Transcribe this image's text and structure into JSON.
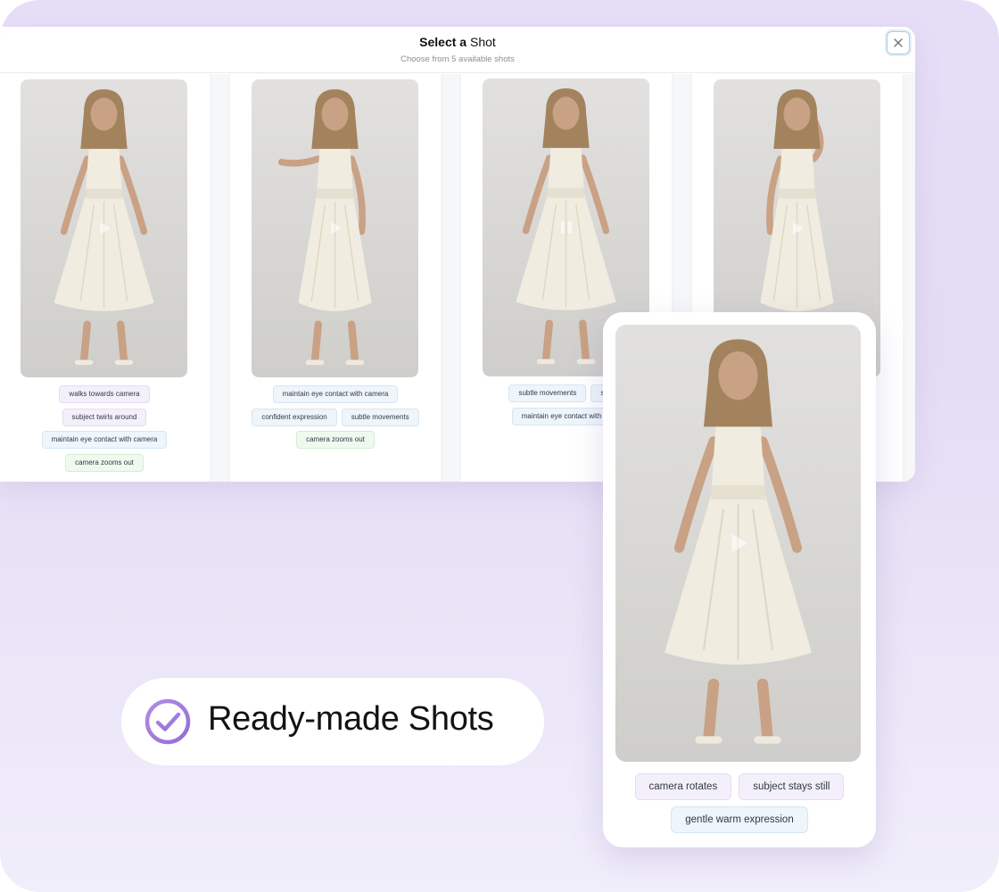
{
  "modal": {
    "title_bold": "Select a",
    "title_rest": " Shot",
    "subtitle": "Choose from 5 available shots",
    "close_icon": "close-icon"
  },
  "cards": [
    {
      "state": "play",
      "tags": [
        [
          {
            "text": "walks towards camera",
            "color": "purple"
          }
        ],
        [
          {
            "text": "subject twirls around",
            "color": "purple"
          }
        ],
        [
          {
            "text": "maintain eye contact with camera",
            "color": "blue"
          }
        ],
        [
          {
            "text": "camera zooms out",
            "color": "green"
          }
        ]
      ]
    },
    {
      "state": "play",
      "tags": [
        [
          {
            "text": "maintain eye contact with camera",
            "color": "blue"
          }
        ],
        [
          {
            "text": "confident expression",
            "color": "blue"
          },
          {
            "text": "subtle movements",
            "color": "blue"
          }
        ],
        [
          {
            "text": "camera zooms out",
            "color": "green"
          }
        ]
      ]
    },
    {
      "state": "pause",
      "tags": [
        [
          {
            "text": "subtle movements",
            "color": "blue"
          },
          {
            "text": "subt",
            "color": "blue"
          }
        ],
        [
          {
            "text": "maintain eye contact with ca",
            "color": "blue"
          }
        ]
      ]
    },
    {
      "state": "play",
      "tags": []
    }
  ],
  "preview": {
    "state": "play",
    "tags": [
      [
        {
          "text": "camera rotates",
          "color": "purple"
        },
        {
          "text": "subject stays still",
          "color": "purple"
        }
      ],
      [
        {
          "text": "gentle warm expression",
          "color": "blue"
        }
      ]
    ]
  },
  "badge": {
    "label": "Ready-made Shots",
    "icon": "check-circle-icon",
    "accent": "#a07ce0"
  },
  "colors": {
    "background": "#e6def7",
    "tag_purple": "#f3f0fb",
    "tag_blue": "#eef5fb",
    "tag_green": "#effaef"
  }
}
